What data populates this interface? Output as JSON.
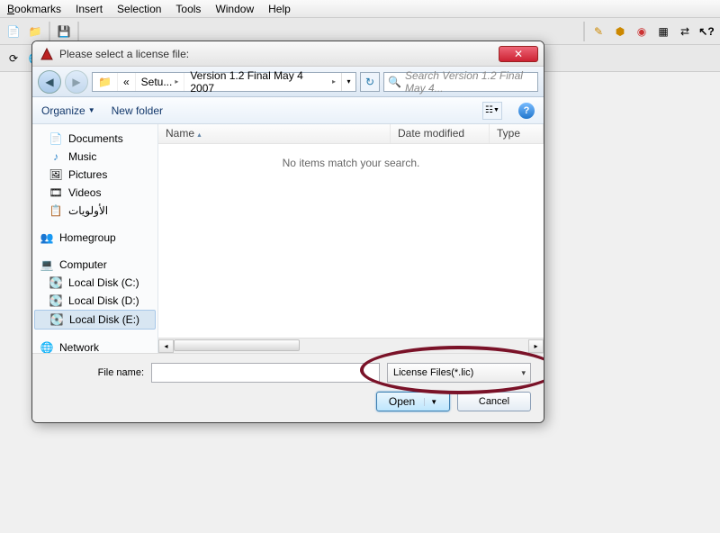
{
  "menus": {
    "bookmarks": "ookmarks",
    "insert": "Insert",
    "selection": "Selection",
    "tools": "Tools",
    "window": "Window",
    "help": "Help"
  },
  "dialog": {
    "title": "Please select a license file:",
    "addr": {
      "seg1": "Setu...",
      "seg2": "Version 1.2 Final May 4 2007"
    },
    "search_placeholder": "Search Version 1.2 Final May 4...",
    "cmd": {
      "organize": "Organize",
      "newfolder": "New folder"
    },
    "cols": {
      "name": "Name",
      "date": "Date modified",
      "type": "Type"
    },
    "empty": "No items match your search.",
    "fn_label": "File name:",
    "fn_value": "",
    "filter": "License Files(*.lic)",
    "open": "Open",
    "cancel": "Cancel"
  },
  "nav": {
    "documents": "Documents",
    "music": "Music",
    "pictures": "Pictures",
    "videos": "Videos",
    "arabic": "الأولويات",
    "homegroup": "Homegroup",
    "computer": "Computer",
    "disk_c": "Local Disk (C:)",
    "disk_d": "Local Disk (D:)",
    "disk_e": "Local Disk (E:)",
    "network": "Network"
  }
}
